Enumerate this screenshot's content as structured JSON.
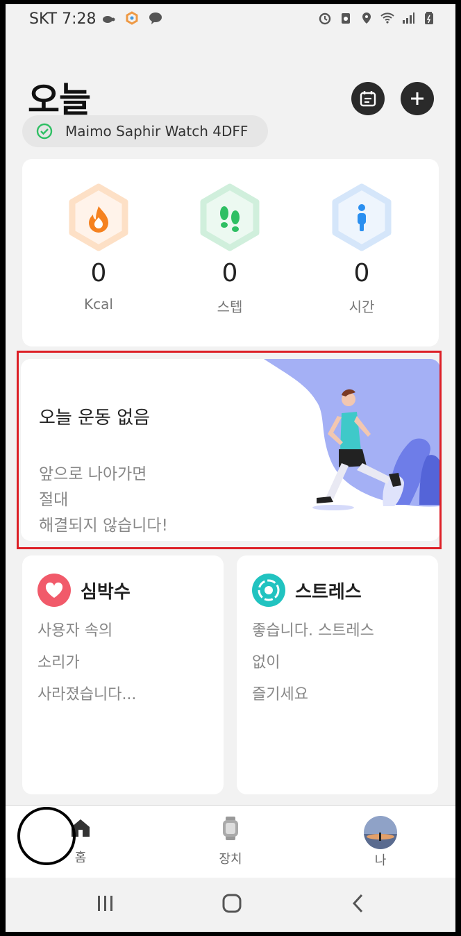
{
  "status_bar": {
    "carrier_time": "SKT 7:28",
    "left_icons": [
      "turtle-icon",
      "colorful-hex-icon",
      "talk-icon"
    ],
    "right_icons": [
      "alarm-icon",
      "recycle-icon",
      "location-icon",
      "wifi-icon",
      "signal-icon",
      "battery-icon"
    ]
  },
  "header": {
    "title": "오늘",
    "device_name": "Maimo Saphir Watch 4DFF"
  },
  "stats": [
    {
      "value": "0",
      "label": "Kcal",
      "icon": "flame-icon",
      "color": "#f58220",
      "bg": "#fde3cc"
    },
    {
      "value": "0",
      "label": "스텝",
      "icon": "footprints-icon",
      "color": "#2ebf63",
      "bg": "#d3f1de"
    },
    {
      "value": "0",
      "label": "시간",
      "icon": "person-icon",
      "color": "#2a8ff0",
      "bg": "#d6e7fb"
    }
  ],
  "workout": {
    "title": "오늘 운동 없음",
    "desc_lines": [
      "앞으로 나아가면",
      "절대",
      "해결되지 않습니다!"
    ]
  },
  "heart": {
    "title": "심박수",
    "lines": [
      "사용자 속의",
      "소리가",
      "사라졌습니다..."
    ],
    "color": "#f15a6a"
  },
  "stress": {
    "title": "스트레스",
    "lines": [
      "좋습니다. 스트레스",
      "없이",
      "즐기세요"
    ],
    "color": "#21c3c0"
  },
  "tabs": [
    {
      "label": "홈",
      "icon": "home-icon"
    },
    {
      "label": "장치",
      "icon": "watch-icon"
    },
    {
      "label": "나",
      "icon": "avatar"
    }
  ]
}
